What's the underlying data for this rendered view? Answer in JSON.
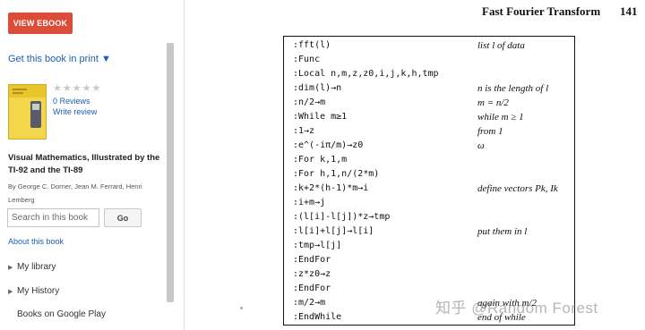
{
  "sidebar": {
    "view_ebook_label": "VIEW EBOOK",
    "print_link": "Get this book in print ▼",
    "rating_stars": "★★★★★",
    "reviews_link": "0 Reviews",
    "write_review_link": "Write review",
    "book_title": "Visual Mathematics, Illustrated by the TI-92 and the TI-89",
    "book_authors": "By George C. Dorner, Jean M. Ferrard, Henri Lemberg",
    "search_placeholder": "Search in this book",
    "search_button": "Go",
    "about_link": "About this book",
    "nav": [
      {
        "label": "My library",
        "arrow": "▶"
      },
      {
        "label": "My History",
        "arrow": "▶"
      },
      {
        "label": "Books on Google Play",
        "arrow": ""
      }
    ]
  },
  "page": {
    "header": "Fast Fourier Transform",
    "page_number": "141",
    "listing": [
      {
        "code": ":fft(l)",
        "comment": "list l of data"
      },
      {
        "code": ":Func",
        "comment": ""
      },
      {
        "code": ":Local n,m,z,z0,i,j,k,h,tmp",
        "comment": ""
      },
      {
        "code": ":dim(l)→n",
        "comment": "n is the length of l"
      },
      {
        "code": ":n/2→m",
        "comment": "m = n/2"
      },
      {
        "code": ":While m≥1",
        "comment": "while m ≥ 1"
      },
      {
        "code": ":1→z",
        "comment": "from 1"
      },
      {
        "code": ":e^(-iπ/m)→z0",
        "comment": "ω"
      },
      {
        "code": ":For k,1,m",
        "comment": ""
      },
      {
        "code": ":For h,1,n/(2*m)",
        "comment": ""
      },
      {
        "code": ":k+2*(h-1)*m→i",
        "comment": "define vectors Pk, Ik"
      },
      {
        "code": ":i+m→j",
        "comment": ""
      },
      {
        "code": ":(l[i]-l[j])*z→tmp",
        "comment": ""
      },
      {
        "code": ":l[i]+l[j]→l[i]",
        "comment": "put them in l"
      },
      {
        "code": ":tmp→l[j]",
        "comment": ""
      },
      {
        "code": ":EndFor",
        "comment": ""
      },
      {
        "code": ":z*z0→z",
        "comment": ""
      },
      {
        "code": ":EndFor",
        "comment": ""
      },
      {
        "code": ":m/2→m",
        "comment": "again with m/2"
      },
      {
        "code": ":EndWhile",
        "comment": "end of while"
      }
    ]
  },
  "watermark": "知乎 @Random Forest",
  "colors": {
    "ebook_button": "#dd4b39",
    "link": "#1a5fb4"
  }
}
